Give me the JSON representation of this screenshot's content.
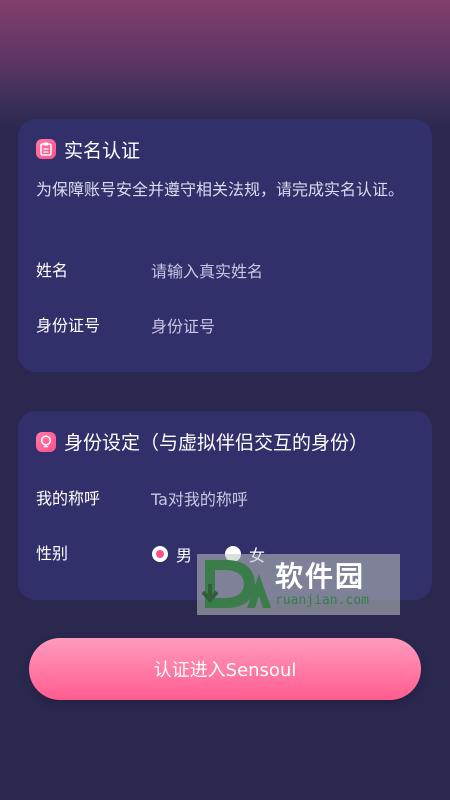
{
  "realname_card": {
    "icon": "clipboard-icon",
    "title": "实名认证",
    "description": "为保障账号安全并遵守相关法规，请完成实名认证。",
    "fields": [
      {
        "label": "姓名",
        "placeholder": "请输入真实姓名",
        "value": ""
      },
      {
        "label": "身份证号",
        "placeholder": "身份证号",
        "value": ""
      }
    ]
  },
  "identity_card": {
    "icon": "bulb-icon",
    "title": "身份设定（与虚拟伴侣交互的身份）",
    "nickname": {
      "label": "我的称呼",
      "placeholder": "Ta对我的称呼",
      "value": ""
    },
    "gender": {
      "label": "性别",
      "options": [
        {
          "label": "男",
          "selected": true
        },
        {
          "label": "女",
          "selected": false
        }
      ]
    }
  },
  "watermark": {
    "brand": "软件园",
    "url": "ruanjian.com"
  },
  "submit": {
    "label": "认证进入Sensoul"
  },
  "colors": {
    "accent": "#ff4f8b",
    "card": "#32306a",
    "background": "#2b2850"
  }
}
